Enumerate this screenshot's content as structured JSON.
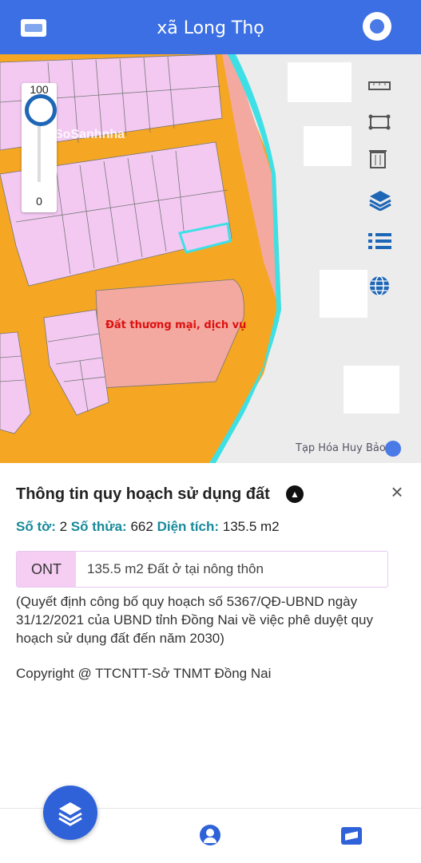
{
  "header": {
    "title": "xã Long Thọ"
  },
  "map": {
    "zone_label": "Đất thương mại, dịch vụ",
    "poi_label": "Tạp Hóa Huy Bảo",
    "watermark": "SoSanhnha",
    "opacity_slider": {
      "max_label": "100",
      "min_label": "0",
      "value": 100
    },
    "tools": [
      "measure-distance-icon",
      "measure-area-icon",
      "trash-icon",
      "layers-icon",
      "list-icon",
      "globe-icon"
    ]
  },
  "panel": {
    "title": "Thông tin quy hoạch sử dụng đất",
    "sheet_label": "Số tờ:",
    "sheet_value": "2",
    "parcel_label": "Số thửa:",
    "parcel_value": "662",
    "area_label": "Diện tích:",
    "area_value": "135.5 m2",
    "land_code": "ONT",
    "land_desc": "135.5 m2 Đất ở tại nông thôn",
    "decision": "(Quyết định công bố quy hoạch số 5367/QĐ-UBND ngày 31/12/2021 của UBND tỉnh Đồng Nai về việc phê duyệt quy hoạch sử dụng đất đến năm 2030)",
    "copyright": "Copyright @ TTCNTT-Sở TNMT Đồng Nai"
  },
  "colors": {
    "header": "#3b6fe3",
    "road": "#f5a623",
    "residential": "#f3c9f2",
    "commercial": "#f3a9a0",
    "river": "#3ee0e6",
    "accent": "#188a9b"
  }
}
